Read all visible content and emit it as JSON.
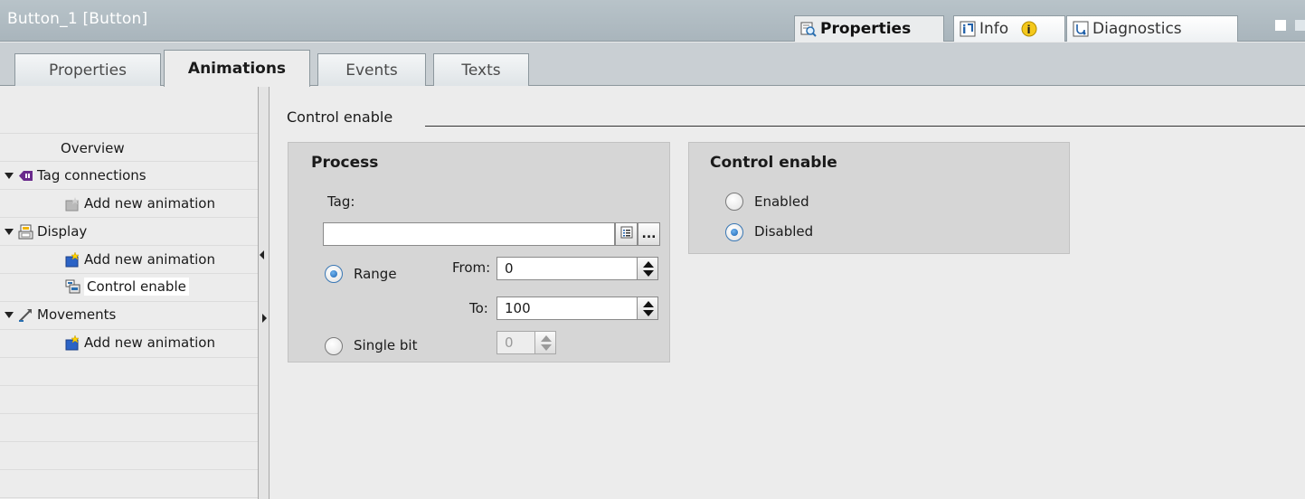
{
  "window": {
    "title": "Button_1 [Button]",
    "inspector_tabs": [
      {
        "label": "Properties",
        "icon": "properties-magnifier-icon",
        "active": true
      },
      {
        "label": "Info",
        "icon": "info-icon",
        "badge_icon": "info-badge-icon"
      },
      {
        "label": "Diagnostics",
        "icon": "diagnostics-icon"
      }
    ]
  },
  "tabs": [
    {
      "label": "Properties"
    },
    {
      "label": "Animations",
      "active": true
    },
    {
      "label": "Events"
    },
    {
      "label": "Texts"
    }
  ],
  "nav": {
    "overview": "Overview",
    "tag_connections": {
      "label": "Tag connections",
      "icon": "tag-connection-icon",
      "children": [
        "Add new animation"
      ]
    },
    "display": {
      "label": "Display",
      "icon": "display-icon",
      "children": [
        "Add new animation",
        "Control enable"
      ]
    },
    "movements": {
      "label": "Movements",
      "icon": "movement-icon",
      "children": [
        "Add new animation"
      ]
    },
    "selected": "Control enable"
  },
  "main": {
    "section_title": "Control enable",
    "process": {
      "title": "Process",
      "tag_label": "Tag:",
      "tag_value": "",
      "range_label": "Range",
      "from_label": "From:",
      "from_value": "0",
      "to_label": "To:",
      "to_value": "100",
      "single_bit_label": "Single bit",
      "single_bit_value": "0",
      "ellipsis": "...",
      "selected_mode": "Range"
    },
    "control_enable": {
      "title": "Control enable",
      "options": [
        "Enabled",
        "Disabled"
      ],
      "selected": "Disabled"
    }
  },
  "colors": {
    "titlebar": "#aab6bd",
    "radio_selected": "#1c63b1",
    "panel": "#d6d6d6"
  }
}
